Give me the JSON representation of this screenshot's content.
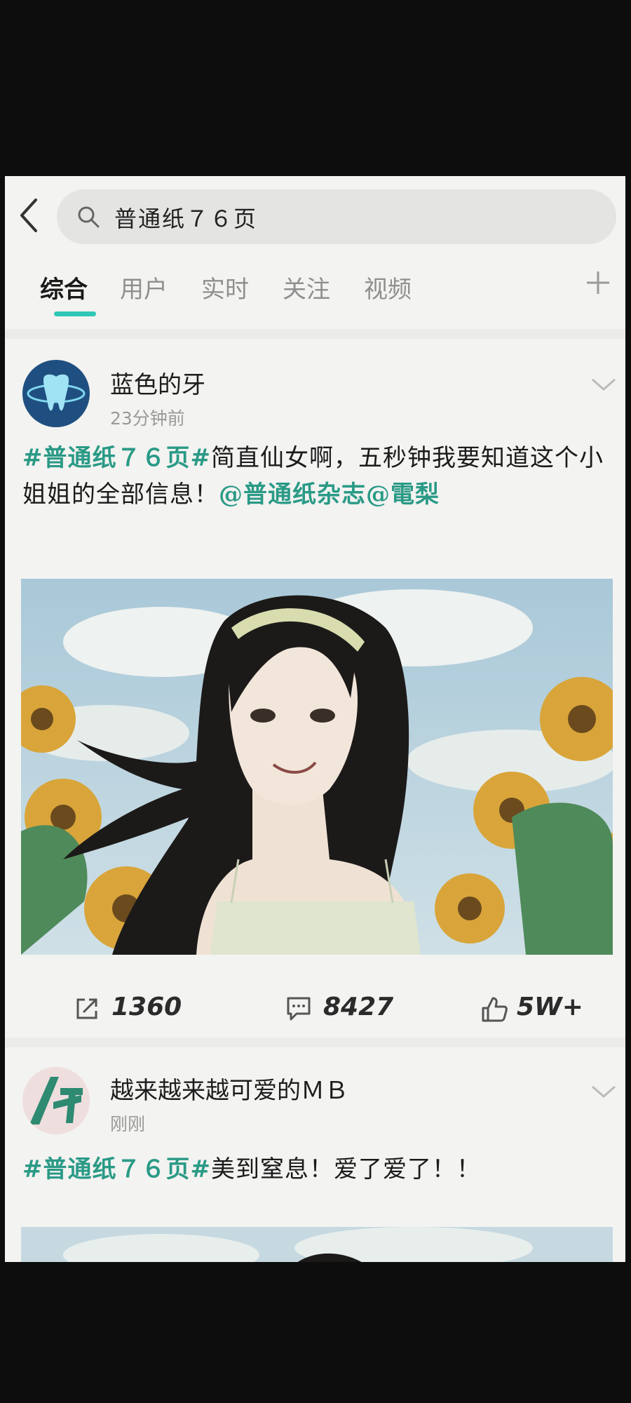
{
  "search": {
    "query": "普通纸７６页"
  },
  "tabs": [
    {
      "label": "综合",
      "active": true
    },
    {
      "label": "用户"
    },
    {
      "label": "实时"
    },
    {
      "label": "关注"
    },
    {
      "label": "视频"
    }
  ],
  "colors": {
    "accent": "#2ec7b5",
    "tag": "#2a9a86",
    "background": "#f3f3f1"
  },
  "posts": [
    {
      "username": "蓝色的牙",
      "time": "23分钟前",
      "text": {
        "tag": "#普通纸７６页#",
        "body": "简直仙女啊，五秒钟我要知道这个小姐姐的全部信息！",
        "mention1": "@普通纸杂志",
        "mention2": "@電梨"
      },
      "stats": {
        "repost": "1360",
        "comments": "8427",
        "likes": "5W+"
      }
    },
    {
      "username": "越来越来越可爱的ＭＢ",
      "time": "刚刚",
      "text": {
        "tag": "#普通纸７６页#",
        "body": "美到窒息！爱了爱了！！"
      }
    }
  ],
  "icons": [
    "back-arrow-icon",
    "search-icon",
    "plus-icon",
    "chevron-down-icon",
    "share-icon",
    "comment-icon",
    "thumbs-up-icon"
  ]
}
